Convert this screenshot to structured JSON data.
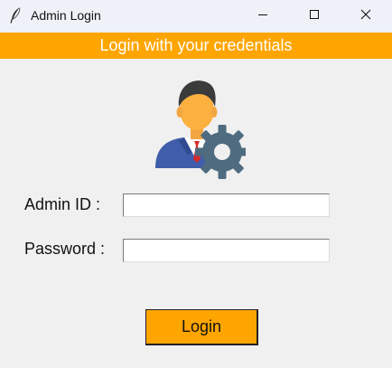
{
  "window": {
    "title": "Admin Login",
    "app_icon": "feather-icon"
  },
  "controls": {
    "minimize_icon": "minimize-icon",
    "maximize_icon": "maximize-icon",
    "close_icon": "close-icon"
  },
  "banner": {
    "text": "Login with your credentials"
  },
  "image": {
    "icon": "admin-settings-icon"
  },
  "form": {
    "admin_id_label": "Admin ID :",
    "admin_id_value": "",
    "password_label": "Password :",
    "password_value": "",
    "login_button": "Login"
  },
  "colors": {
    "accent": "#ffa500",
    "background": "#f0f0f0",
    "banner_text": "#ffffff"
  }
}
